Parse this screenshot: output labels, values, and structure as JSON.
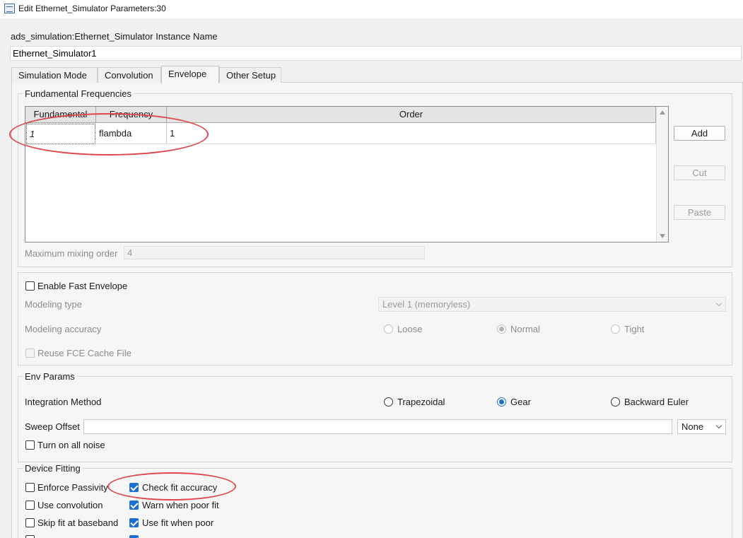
{
  "window": {
    "title": "Edit Ethernet_Simulator Parameters:30"
  },
  "instance": {
    "label": "ads_simulation:Ethernet_Simulator Instance Name",
    "value": "Ethernet_Simulator1"
  },
  "tabs": [
    "Simulation Mode",
    "Convolution",
    "Envelope",
    "Other Setup"
  ],
  "active_tab": "Envelope",
  "fundamental": {
    "group_title": "Fundamental Frequencies",
    "columns": [
      "Fundamental",
      "Frequency",
      "Order"
    ],
    "rows": [
      {
        "fundamental": "1",
        "frequency": "flambda",
        "order": "1"
      }
    ],
    "buttons": {
      "add": "Add",
      "cut": "Cut",
      "paste": "Paste"
    },
    "max_mixing_label": "Maximum mixing order",
    "max_mixing_value": "4"
  },
  "fast_envelope": {
    "enable_label": "Enable Fast Envelope",
    "modeling_type_label": "Modeling type",
    "modeling_type_value": "Level 1 (memoryless)",
    "modeling_accuracy_label": "Modeling accuracy",
    "accuracy_options": [
      "Loose",
      "Normal",
      "Tight"
    ],
    "accuracy_selected": "Normal",
    "reuse_label": "Reuse FCE Cache File"
  },
  "env_params": {
    "group_title": "Env Params",
    "integration_label": "Integration Method",
    "methods": [
      "Trapezoidal",
      "Gear",
      "Backward Euler"
    ],
    "method_selected": "Gear",
    "sweep_offset_label": "Sweep Offset",
    "sweep_offset_value": "",
    "sweep_unit": "None",
    "noise_label": "Turn on all noise"
  },
  "device_fitting": {
    "group_title": "Device Fitting",
    "enforce_passivity": "Enforce Passivity",
    "check_fit_accuracy": "Check fit accuracy",
    "use_convolution": "Use convolution",
    "warn_when_poor_fit": "Warn when poor fit",
    "skip_fit_baseband": "Skip fit at baseband",
    "use_fit_when_poor": "Use fit when poor"
  },
  "colors": {
    "accent": "#1a6fd1",
    "annotation": "#e0464a"
  }
}
